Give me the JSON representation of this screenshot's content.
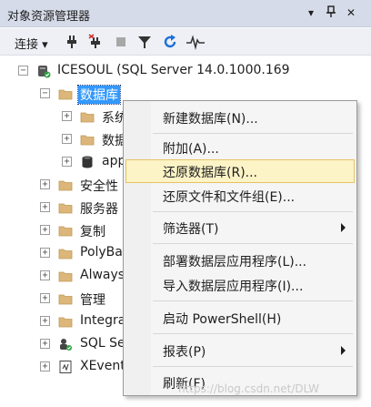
{
  "titlebar": {
    "title": "对象资源管理器",
    "dropdown_glyph": "▾",
    "pin_glyph": "ᛘ",
    "close_glyph": "✕"
  },
  "toolbar": {
    "connect_label": "连接 ▾",
    "icons": [
      "connect-plug-icon",
      "disconnect-icon",
      "stop-icon",
      "filter-icon",
      "refresh-icon",
      "activity-monitor-icon"
    ]
  },
  "tree": {
    "server": "ICESOUL (SQL Server 14.0.1000.169",
    "databases": "数据库",
    "sys_db": "系统",
    "snap_db": "数据",
    "app_db": "app",
    "security": "安全性",
    "server_objects": "服务器",
    "replication": "复制",
    "polybase": "PolyBa",
    "always_on": "Always",
    "management": "管理",
    "integration": "Integra",
    "sql_agent": "SQL Se",
    "xevent": "XEvent"
  },
  "menu": {
    "new_db": "新建数据库(N)...",
    "attach": "附加(A)...",
    "restore_db": "还原数据库(R)...",
    "restore_files": "还原文件和文件组(E)...",
    "filter": "筛选器(T)",
    "deploy_dac": "部署数据层应用程序(L)...",
    "import_dac": "导入数据层应用程序(I)...",
    "powershell": "启动 PowerShell(H)",
    "reports": "报表(P)",
    "refresh": "刷新(F)"
  },
  "watermark": "https://blog.csdn.net/DLW",
  "colors": {
    "selection": "#3399ff",
    "menu_highlight": "#fcf3c6",
    "folder": "#dcb67a",
    "refresh_blue": "#1e6fd9"
  }
}
